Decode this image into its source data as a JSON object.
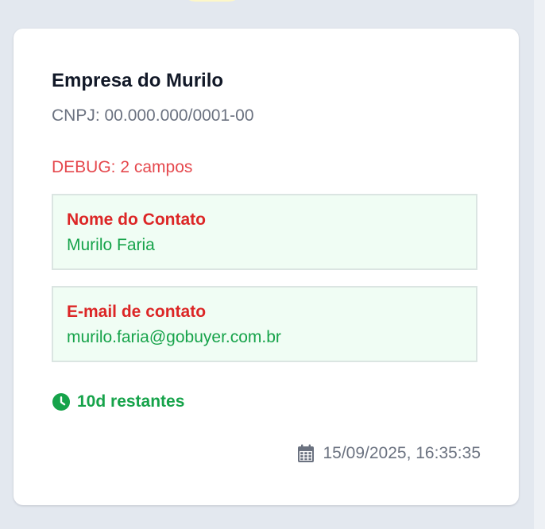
{
  "colors": {
    "page_background": "#e3e8ef",
    "card_background": "#ffffff",
    "title": "#111827",
    "muted": "#6b7280",
    "debug": "#e5484d",
    "field_label": "#dc2626",
    "field_value": "#16a34a",
    "field_background": "#f0fdf4"
  },
  "card": {
    "company_name": "Empresa do Murilo",
    "cnpj": "CNPJ: 00.000.000/0001-00",
    "debug_text": "DEBUG: 2 campos",
    "fields": [
      {
        "label": "Nome do Contato",
        "value": "Murilo Faria"
      },
      {
        "label": "E-mail de contato",
        "value": "murilo.faria@gobuyer.com.br"
      }
    ],
    "deadline": {
      "icon": "clock-icon",
      "text": "10d restantes"
    },
    "timestamp": {
      "icon": "calendar-icon",
      "text": "15/09/2025, 16:35:35"
    }
  }
}
